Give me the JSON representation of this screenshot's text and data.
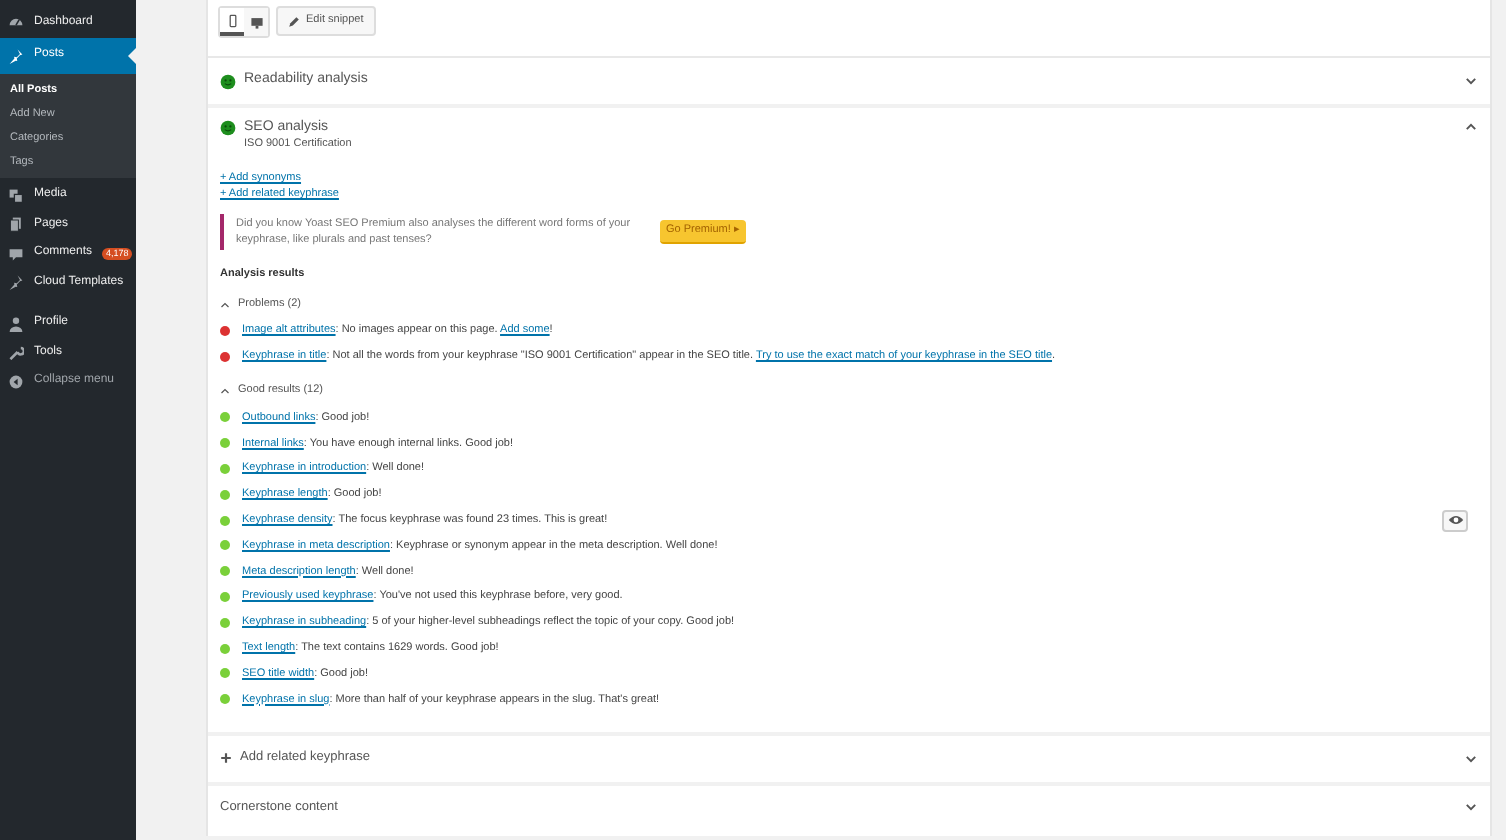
{
  "sidebar": {
    "items": [
      {
        "label": "Dashboard",
        "kind": "gauge",
        "selected": false
      },
      {
        "label": "Posts",
        "kind": "pin",
        "selected": true,
        "children": [
          {
            "label": "All Posts",
            "selected": true
          },
          {
            "label": "Add New",
            "selected": false
          },
          {
            "label": "Categories",
            "selected": false
          },
          {
            "label": "Tags",
            "selected": false
          }
        ]
      },
      {
        "label": "Media",
        "kind": "media",
        "selected": false
      },
      {
        "label": "Pages",
        "kind": "pages",
        "selected": false
      },
      {
        "label": "Comments",
        "kind": "comment",
        "selected": false,
        "badge": "4,178"
      },
      {
        "label": "Cloud Templates",
        "kind": "pin",
        "selected": false
      },
      {
        "label": "Profile",
        "kind": "user",
        "selected": false,
        "gap": true
      },
      {
        "label": "Tools",
        "kind": "wrench",
        "selected": false
      },
      {
        "label": "Collapse menu",
        "kind": "collapse",
        "selected": false
      }
    ]
  },
  "snippet": {
    "views": [
      {
        "kind": "mobile",
        "selected": true
      },
      {
        "kind": "desktop",
        "selected": false
      }
    ],
    "edit_button": "Edit snippet"
  },
  "readability": {
    "title": "Readability analysis",
    "expanded": false
  },
  "seo": {
    "title": "SEO analysis",
    "expanded": true,
    "keyphrase": "ISO 9001 Certification",
    "links": [
      "+ Add synonyms",
      "+ Add related keyphrase"
    ],
    "notice": {
      "text": "Did you know Yoast SEO Premium also analyses the different word forms of your keyphrase, like plurals and past tenses?",
      "button": "Go Premium! ▸"
    },
    "results_title": "Analysis results",
    "groups": [
      {
        "title": "Problems (2)",
        "expanded": true,
        "items": [
          {
            "color": "#dc3232",
            "parts": [
              {
                "text": "Image alt attributes",
                "link": true
              },
              {
                "text": ": No images appear on this page. ",
                "link": false
              },
              {
                "text": "Add some",
                "link": true
              },
              {
                "text": "!",
                "link": false
              }
            ]
          },
          {
            "color": "#dc3232",
            "parts": [
              {
                "text": "Keyphrase in title",
                "link": true
              },
              {
                "text": ": Not all the words from your keyphrase \"ISO 9001 Certification\" appear in the SEO title. ",
                "link": false
              },
              {
                "text": "Try to use the exact match of your keyphrase in the SEO title",
                "link": true
              },
              {
                "text": ".",
                "link": false
              }
            ]
          }
        ]
      },
      {
        "title": "Good results (12)",
        "expanded": true,
        "items": [
          {
            "color": "#7ad03a",
            "parts": [
              {
                "text": "Outbound links",
                "link": true
              },
              {
                "text": ": Good job!",
                "link": false
              }
            ]
          },
          {
            "color": "#7ad03a",
            "parts": [
              {
                "text": "Internal links",
                "link": true
              },
              {
                "text": ": You have enough internal links. Good job!",
                "link": false
              }
            ]
          },
          {
            "color": "#7ad03a",
            "parts": [
              {
                "text": "Keyphrase in introduction",
                "link": true
              },
              {
                "text": ": Well done!",
                "link": false
              }
            ]
          },
          {
            "color": "#7ad03a",
            "parts": [
              {
                "text": "Keyphrase length",
                "link": true
              },
              {
                "text": ": Good job!",
                "link": false
              }
            ]
          },
          {
            "color": "#7ad03a",
            "eye": true,
            "parts": [
              {
                "text": "Keyphrase density",
                "link": true
              },
              {
                "text": ": The focus keyphrase was found 23 times. This is great!",
                "link": false
              }
            ]
          },
          {
            "color": "#7ad03a",
            "parts": [
              {
                "text": "Keyphrase in meta description",
                "link": true
              },
              {
                "text": ": Keyphrase or synonym appear in the meta description. Well done!",
                "link": false
              }
            ]
          },
          {
            "color": "#7ad03a",
            "parts": [
              {
                "text": "Meta description length",
                "link": true
              },
              {
                "text": ": Well done!",
                "link": false
              }
            ]
          },
          {
            "color": "#7ad03a",
            "parts": [
              {
                "text": "Previously used keyphrase",
                "link": true
              },
              {
                "text": ": You've not used this keyphrase before, very good.",
                "link": false
              }
            ]
          },
          {
            "color": "#7ad03a",
            "parts": [
              {
                "text": "Keyphrase in subheading",
                "link": true
              },
              {
                "text": ": 5 of your higher-level subheadings reflect the topic of your copy. Good job!",
                "link": false
              }
            ]
          },
          {
            "color": "#7ad03a",
            "parts": [
              {
                "text": "Text length",
                "link": true
              },
              {
                "text": ": The text contains 1629 words. Good job!",
                "link": false
              }
            ]
          },
          {
            "color": "#7ad03a",
            "parts": [
              {
                "text": "SEO title width",
                "link": true
              },
              {
                "text": ": Good job!",
                "link": false
              }
            ]
          },
          {
            "color": "#7ad03a",
            "parts": [
              {
                "text": "Keyphrase in slug",
                "link": true
              },
              {
                "text": ": More than half of your keyphrase appears in the slug. That's great!",
                "link": false
              }
            ]
          }
        ]
      }
    ]
  },
  "footer_sections": [
    {
      "title": "Add related keyphrase",
      "kind": "add",
      "expanded": false
    },
    {
      "title": "Cornerstone content",
      "kind": "plain",
      "expanded": false
    }
  ]
}
